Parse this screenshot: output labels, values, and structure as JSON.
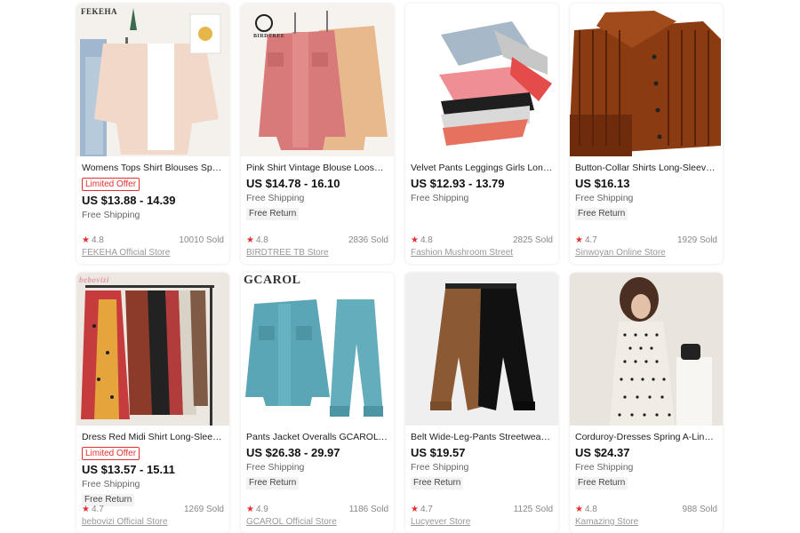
{
  "products": [
    {
      "brand_label": "FEKEHA",
      "title": "Womens Tops Shirt Blouses Spring...",
      "badge": "Limited Offer",
      "price": "US $13.88 - 14.39",
      "shipping": "Free Shipping",
      "return_label": "",
      "rating": "4.8",
      "sold": "10010 Sold",
      "store": "FEKEHA Official Store"
    },
    {
      "brand_label": "BIRDTREE",
      "title": "Pink Shirt Vintage Blouse Loose To...",
      "badge": "",
      "price": "US $14.78 - 16.10",
      "shipping": "Free Shipping",
      "return_label": "Free Return",
      "rating": "4.8",
      "sold": "2836 Sold",
      "store": "BIRDTREE TB Store"
    },
    {
      "brand_label": "",
      "title": "Velvet Pants Leggings Girls Long-T...",
      "badge": "",
      "price": "US $12.93 - 13.79",
      "shipping": "Free Shipping",
      "return_label": "",
      "rating": "4.8",
      "sold": "2825 Sold",
      "store": "Fashion Mushroom Street"
    },
    {
      "brand_label": "",
      "title": "Button-Collar Shirts Long-Sleeved ...",
      "badge": "",
      "price": "US $16.13",
      "shipping": "Free Shipping",
      "return_label": "Free Return",
      "rating": "4.7",
      "sold": "1929 Sold",
      "store": "Sinwoyan Online Store"
    },
    {
      "brand_label": "bebovizi",
      "title": "Dress Red Midi Shirt Long-Sleeve P...",
      "badge": "Limited Offer",
      "price": "US $13.57 - 15.11",
      "shipping": "Free Shipping",
      "return_label": "Free Return",
      "rating": "4.7",
      "sold": "1269 Sold",
      "store": "bebovizi Official Store"
    },
    {
      "brand_label": "GCAROL",
      "title": "Pants Jacket Overalls GCAROL Velv...",
      "badge": "",
      "price": "US $26.38 - 29.97",
      "shipping": "Free Shipping",
      "return_label": "Free Return",
      "rating": "4.9",
      "sold": "1186 Sold",
      "store": "GCAROL Official Store"
    },
    {
      "brand_label": "",
      "title": "Belt Wide-Leg-Pants Streetwear Lo...",
      "badge": "",
      "price": "US $19.57",
      "shipping": "Free Shipping",
      "return_label": "Free Return",
      "rating": "4.7",
      "sold": "1125 Sold",
      "store": "Lucyever Store"
    },
    {
      "brand_label": "",
      "title": "Corduroy-Dresses Spring A-Line La...",
      "badge": "",
      "price": "US $24.37",
      "shipping": "Free Shipping",
      "return_label": "Free Return",
      "rating": "4.8",
      "sold": "988 Sold",
      "store": "Kamazing Store"
    }
  ],
  "colors": {
    "badge": "#e62e2e",
    "star": "#e62e2e",
    "price": "#111111"
  },
  "icons": {
    "rating": "star-icon"
  }
}
